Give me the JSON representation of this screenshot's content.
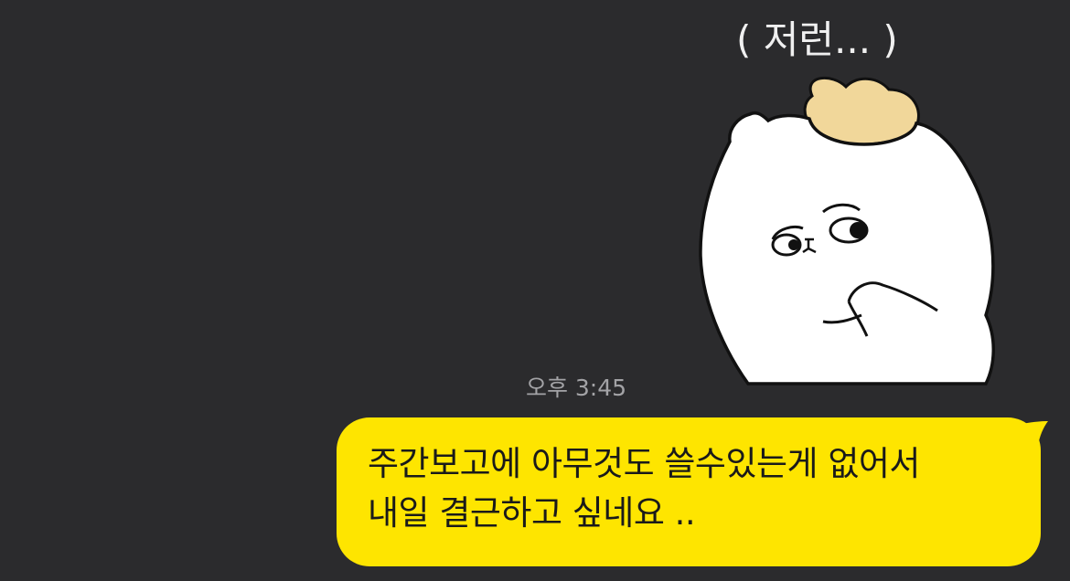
{
  "sticker": {
    "icon": "chick-sticker-icon",
    "caption": "( 저런... )"
  },
  "message": {
    "time": "오후 3:45",
    "text": "주간보고에 아무것도 쓸수있는게 없어서\n내일 결근하고 싶네요 ..",
    "bubble_color": "#fee500"
  },
  "colors": {
    "background": "#2b2b2d",
    "timestamp": "#a3a3a6"
  }
}
